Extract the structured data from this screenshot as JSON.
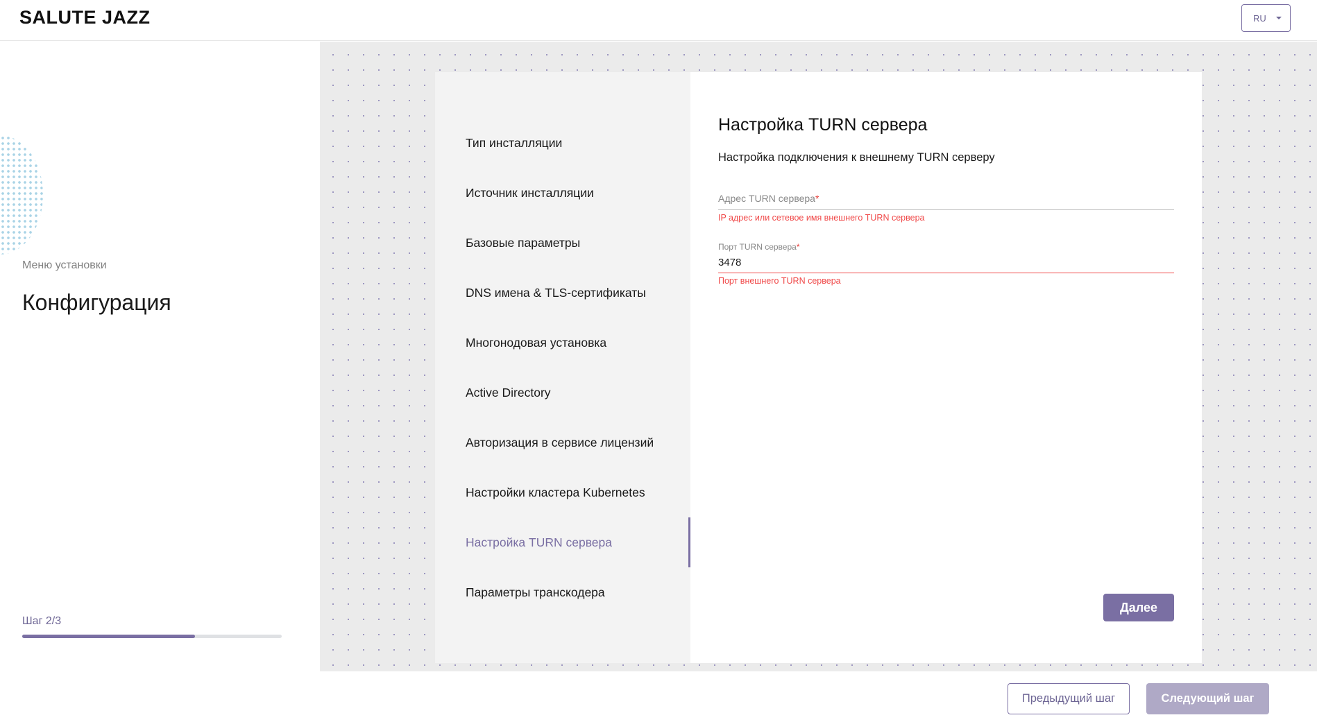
{
  "header": {
    "logo": "SALUTE JAZZ",
    "language": "RU"
  },
  "left": {
    "menu_subtitle": "Меню установки",
    "menu_title": "Конфигурация",
    "step_label": "Шаг 2/3",
    "progress_fraction": 0.667
  },
  "nav": {
    "items": [
      {
        "label": "Тип инсталляции"
      },
      {
        "label": "Источник инсталляции"
      },
      {
        "label": "Базовые параметры"
      },
      {
        "label": "DNS имена & TLS-сертификаты"
      },
      {
        "label": "Многонодовая установка"
      },
      {
        "label": "Active Directory"
      },
      {
        "label": "Авторизация в сервисе лицензий"
      },
      {
        "label": "Настройки кластера Kubernetes"
      },
      {
        "label": "Настройка TURN сервера",
        "active": true
      },
      {
        "label": "Параметры транскодера"
      }
    ]
  },
  "form": {
    "title": "Настройка TURN сервера",
    "subtitle": "Настройка подключения к внешнему TURN серверу",
    "address": {
      "label": "Адрес TURN сервера",
      "required_mark": "*",
      "value": "",
      "error": "IP адрес или сетевое имя внешнего TURN сервера"
    },
    "port": {
      "label": "Порт TURN сервера",
      "required_mark": "*",
      "value": "3478",
      "error": "Порт внешнего TURN сервера"
    },
    "next_label": "Далее"
  },
  "footer": {
    "prev_label": "Предыдущий шаг",
    "next_label": "Следующий шаг"
  },
  "colors": {
    "accent": "#7a6fa3",
    "error": "#f04848",
    "disabled": "#afa9c6"
  }
}
